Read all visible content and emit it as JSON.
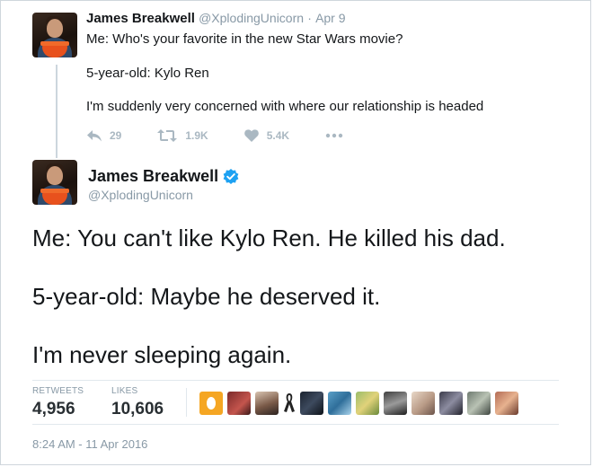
{
  "tweet_reply": {
    "author_name": "James Breakwell",
    "handle": "@XplodingUnicorn",
    "date": "Apr 9",
    "lines": [
      "Me: Who's your favorite in the new Star Wars movie?",
      "5-year-old: Kylo Ren",
      "I'm suddenly very concerned with where our relationship is headed"
    ],
    "actions": {
      "reply_count": "29",
      "retweet_count": "1.9K",
      "like_count": "5.4K"
    }
  },
  "tweet_main": {
    "author_name": "James Breakwell",
    "handle": "@XplodingUnicorn",
    "lines": [
      "Me: You can't like Kylo Ren. He killed his dad.",
      "5-year-old: Maybe he deserved it.",
      "I'm never sleeping again."
    ],
    "stats": {
      "retweets_label": "RETWEETS",
      "retweets_value": "4,956",
      "likes_label": "LIKES",
      "likes_value": "10,606"
    },
    "timestamp": "8:24 AM - 11 Apr 2016"
  },
  "icons": {
    "reply": "reply-icon",
    "retweet": "retweet-icon",
    "like": "heart-icon",
    "more": "more-icon",
    "verified": "verified-badge-icon"
  },
  "colors": {
    "action_gray": "#aab8c2",
    "verified_blue": "#1da1f2",
    "secondary_text": "#8899a6"
  }
}
